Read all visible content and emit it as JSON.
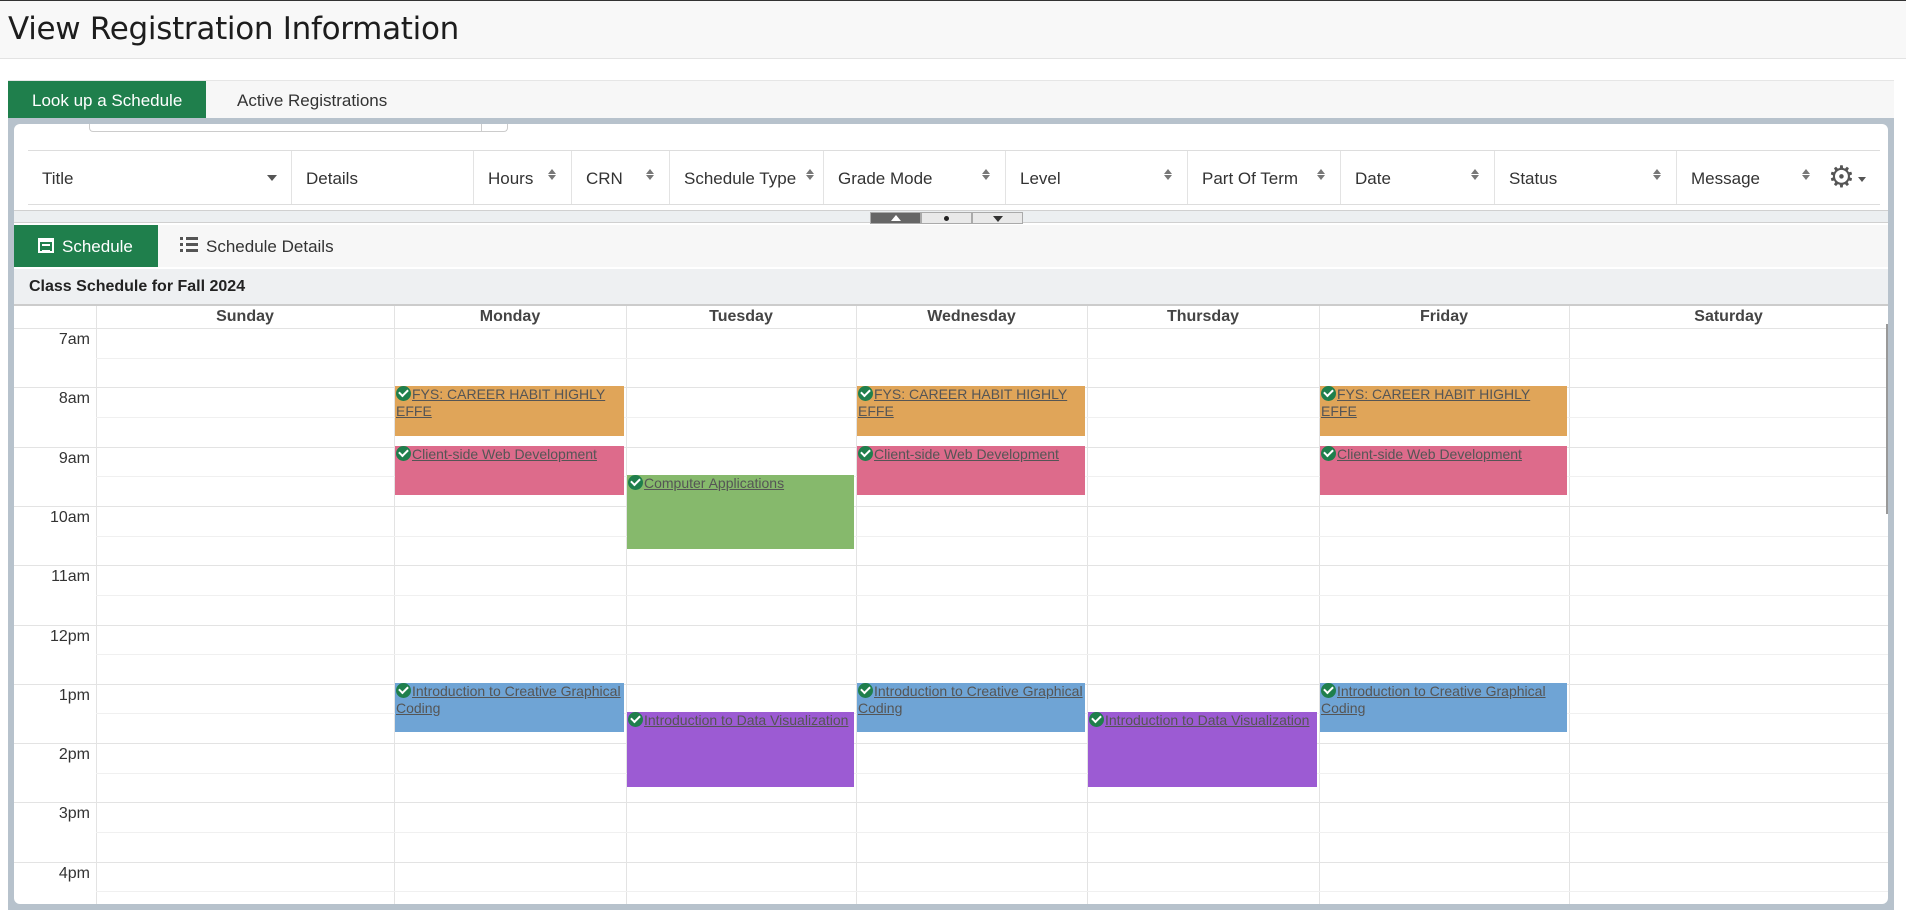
{
  "page": {
    "title": "View Registration Information"
  },
  "top_tabs": [
    {
      "label": "Look up a Schedule",
      "active": true
    },
    {
      "label": "Active Registrations",
      "active": false
    }
  ],
  "grid": {
    "columns": [
      "Title",
      "Details",
      "Hours",
      "CRN",
      "Schedule Type",
      "Grade Mode",
      "Level",
      "Part Of Term",
      "Date",
      "Status",
      "Message"
    ],
    "settings_icon": "gear-icon"
  },
  "sub_tabs": [
    {
      "label": "Schedule",
      "icon": "calendar-icon",
      "active": true
    },
    {
      "label": "Schedule Details",
      "icon": "list-icon",
      "active": false
    }
  ],
  "schedule": {
    "caption": "Class Schedule for Fall 2024",
    "days": [
      "Sunday",
      "Monday",
      "Tuesday",
      "Wednesday",
      "Thursday",
      "Friday",
      "Saturday"
    ],
    "times": [
      "7am",
      "8am",
      "9am",
      "10am",
      "11am",
      "12pm",
      "1pm",
      "2pm",
      "3pm",
      "4pm"
    ],
    "status_icon": "check-circle-icon",
    "events": [
      {
        "title": "FYS: CAREER HABIT HIGHLY EFFE",
        "day": "Monday",
        "start": "8:00",
        "end": "8:50",
        "color": "#e0a559"
      },
      {
        "title": "FYS: CAREER HABIT HIGHLY EFFE",
        "day": "Wednesday",
        "start": "8:00",
        "end": "8:50",
        "color": "#e0a559"
      },
      {
        "title": "FYS: CAREER HABIT HIGHLY EFFE",
        "day": "Friday",
        "start": "8:00",
        "end": "8:50",
        "color": "#e0a559"
      },
      {
        "title": "Client-side Web Development",
        "day": "Monday",
        "start": "9:00",
        "end": "9:50",
        "color": "#dd6b8b"
      },
      {
        "title": "Client-side Web Development",
        "day": "Wednesday",
        "start": "9:00",
        "end": "9:50",
        "color": "#dd6b8b"
      },
      {
        "title": "Client-side Web Development",
        "day": "Friday",
        "start": "9:00",
        "end": "9:50",
        "color": "#dd6b8b"
      },
      {
        "title": "Computer Applications",
        "day": "Tuesday",
        "start": "9:30",
        "end": "10:45",
        "color": "#86b96c"
      },
      {
        "title": "Introduction to Creative Graphical Coding",
        "day": "Monday",
        "start": "13:00",
        "end": "13:50",
        "color": "#6fa4d5"
      },
      {
        "title": "Introduction to Creative Graphical Coding",
        "day": "Wednesday",
        "start": "13:00",
        "end": "13:50",
        "color": "#6fa4d5"
      },
      {
        "title": "Introduction to Creative Graphical Coding",
        "day": "Friday",
        "start": "13:00",
        "end": "13:50",
        "color": "#6fa4d5"
      },
      {
        "title": "Introduction to Data Visualization",
        "day": "Tuesday",
        "start": "13:30",
        "end": "14:45",
        "color": "#9c5bd3"
      },
      {
        "title": "Introduction to Data Visualization",
        "day": "Thursday",
        "start": "13:30",
        "end": "14:45",
        "color": "#9c5bd3"
      }
    ]
  }
}
